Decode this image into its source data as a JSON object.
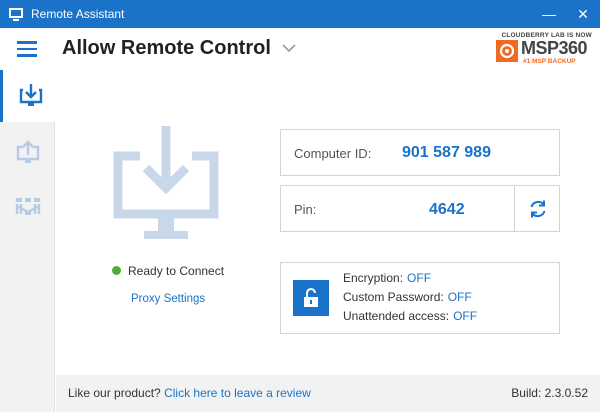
{
  "window": {
    "title": "Remote Assistant",
    "minimize_glyph": "—",
    "close_glyph": "✕"
  },
  "header": {
    "title": "Allow Remote Control",
    "brand_tagline": "CLOUDBERRY LAB IS NOW",
    "brand_name": "MSP360",
    "brand_sub": "#1 MSP BACKUP"
  },
  "sidebar": {
    "items": [
      {
        "name": "allow-control",
        "icon": "download-monitor-icon",
        "active": true
      },
      {
        "name": "connect",
        "icon": "upload-monitor-icon",
        "active": false
      },
      {
        "name": "network",
        "icon": "network-icon",
        "active": false
      }
    ]
  },
  "main": {
    "status": "Ready to Connect",
    "proxy_settings": "Proxy Settings",
    "computer_id_label": "Computer ID:",
    "computer_id": "901 587 989",
    "pin_label": "Pin:",
    "pin": "4642",
    "security": {
      "encryption_label": "Encryption:",
      "encryption_value": "OFF",
      "custom_password_label": "Custom Password:",
      "custom_password_value": "OFF",
      "unattended_label": "Unattended access:",
      "unattended_value": "OFF"
    }
  },
  "footer": {
    "prompt": "Like our product?",
    "review_link": "Click here to leave a review",
    "build": "Build: 2.3.0.52"
  },
  "colors": {
    "accent": "#1a73c9",
    "brand_orange": "#f26a21",
    "status_green": "#4caf2f"
  }
}
